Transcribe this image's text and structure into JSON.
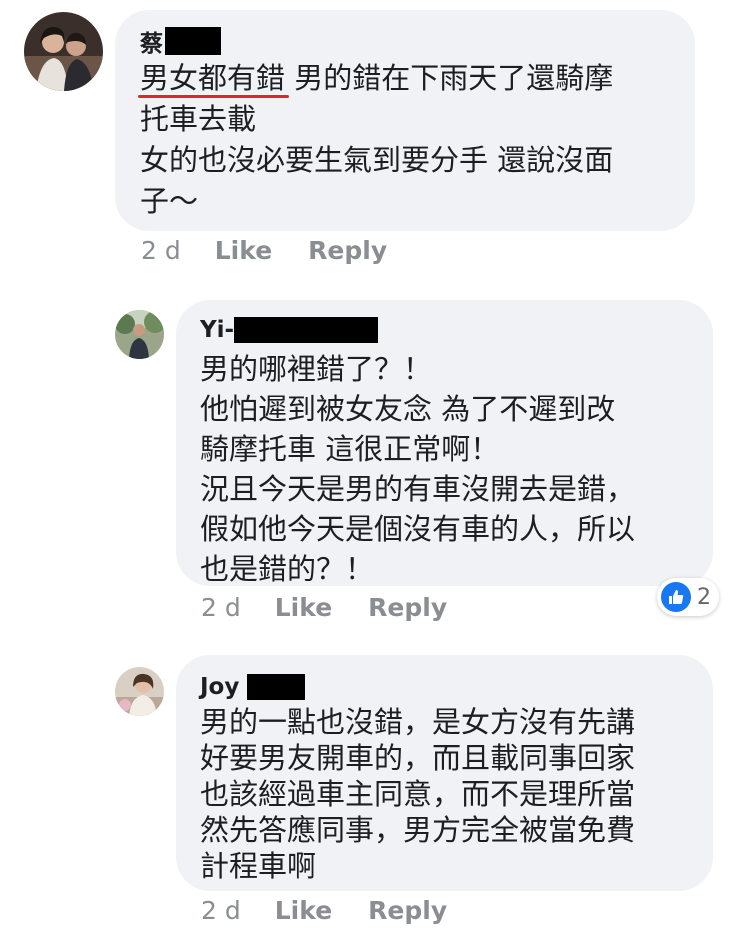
{
  "comments": [
    {
      "author_visible": "蔡",
      "text_highlight": "男女都有錯",
      "text_rest": " 男的錯在下雨天了還騎摩\n托車去載\n女的也沒必要生氣到要分手 還說沒面\n子～",
      "time": "2 d",
      "like_label": "Like",
      "reply_label": "Reply"
    },
    {
      "author_visible": "Yi-",
      "text": "男的哪裡錯了？！\n他怕遲到被女友念  為了不遲到改\n騎摩托車  這很正常啊！\n況且今天是男的有車沒開去是錯，\n假如他今天是個沒有車的人，所以\n也是錯的？！",
      "time": "2 d",
      "like_label": "Like",
      "reply_label": "Reply",
      "reaction_count": "2"
    },
    {
      "author_visible": "Joy",
      "text": "男的一點也沒錯，是女方沒有先講\n好要男友開車的，而且載同事回家\n也該經過車主同意，而不是理所當\n然先答應同事，男方完全被當免費\n計程車啊",
      "time": "2 d",
      "like_label": "Like",
      "reply_label": "Reply"
    }
  ],
  "icons": {
    "reaction": "thumbs-up-icon"
  },
  "colors": {
    "bubble": "#f0f2f5",
    "meta_text": "#8a8d91",
    "highlight_underline": "#e0252b",
    "like_reaction": "#1877f2"
  }
}
